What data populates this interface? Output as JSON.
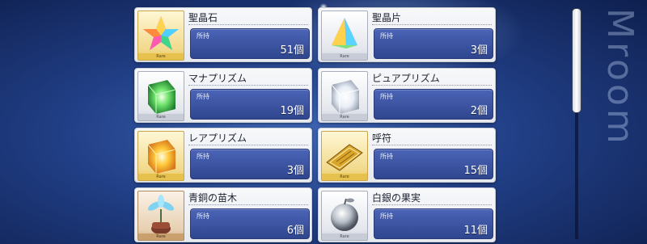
{
  "background": {
    "watermark": "Mroom"
  },
  "owned_label": "所持",
  "items": [
    {
      "name": "聖晶石",
      "count": "51個",
      "rarity": "gold",
      "icon": "saint-quartz-icon",
      "rarity_text": "Rare"
    },
    {
      "name": "聖晶片",
      "count": "3個",
      "rarity": "silver",
      "icon": "quartz-fragment-icon",
      "rarity_text": "Rare"
    },
    {
      "name": "マナプリズム",
      "count": "19個",
      "rarity": "silver",
      "icon": "mana-prism-icon",
      "rarity_text": "Rare"
    },
    {
      "name": "ピュアプリズム",
      "count": "2個",
      "rarity": "silver",
      "icon": "pure-prism-icon",
      "rarity_text": "Rare"
    },
    {
      "name": "レアプリズム",
      "count": "3個",
      "rarity": "gold",
      "icon": "rare-prism-icon",
      "rarity_text": "Rare"
    },
    {
      "name": "呼符",
      "count": "15個",
      "rarity": "gold",
      "icon": "summon-ticket-icon",
      "rarity_text": "Rare"
    },
    {
      "name": "青銅の苗木",
      "count": "6個",
      "rarity": "bronze",
      "icon": "bronze-sapling-icon",
      "rarity_text": "Rare"
    },
    {
      "name": "白銀の果実",
      "count": "11個",
      "rarity": "silver",
      "icon": "silver-apple-icon",
      "rarity_text": "Rare"
    }
  ],
  "colors": {
    "accent": "#2f468f",
    "gold": "#e6c14d",
    "silver": "#c8ccd6",
    "bronze": "#caa06e"
  }
}
